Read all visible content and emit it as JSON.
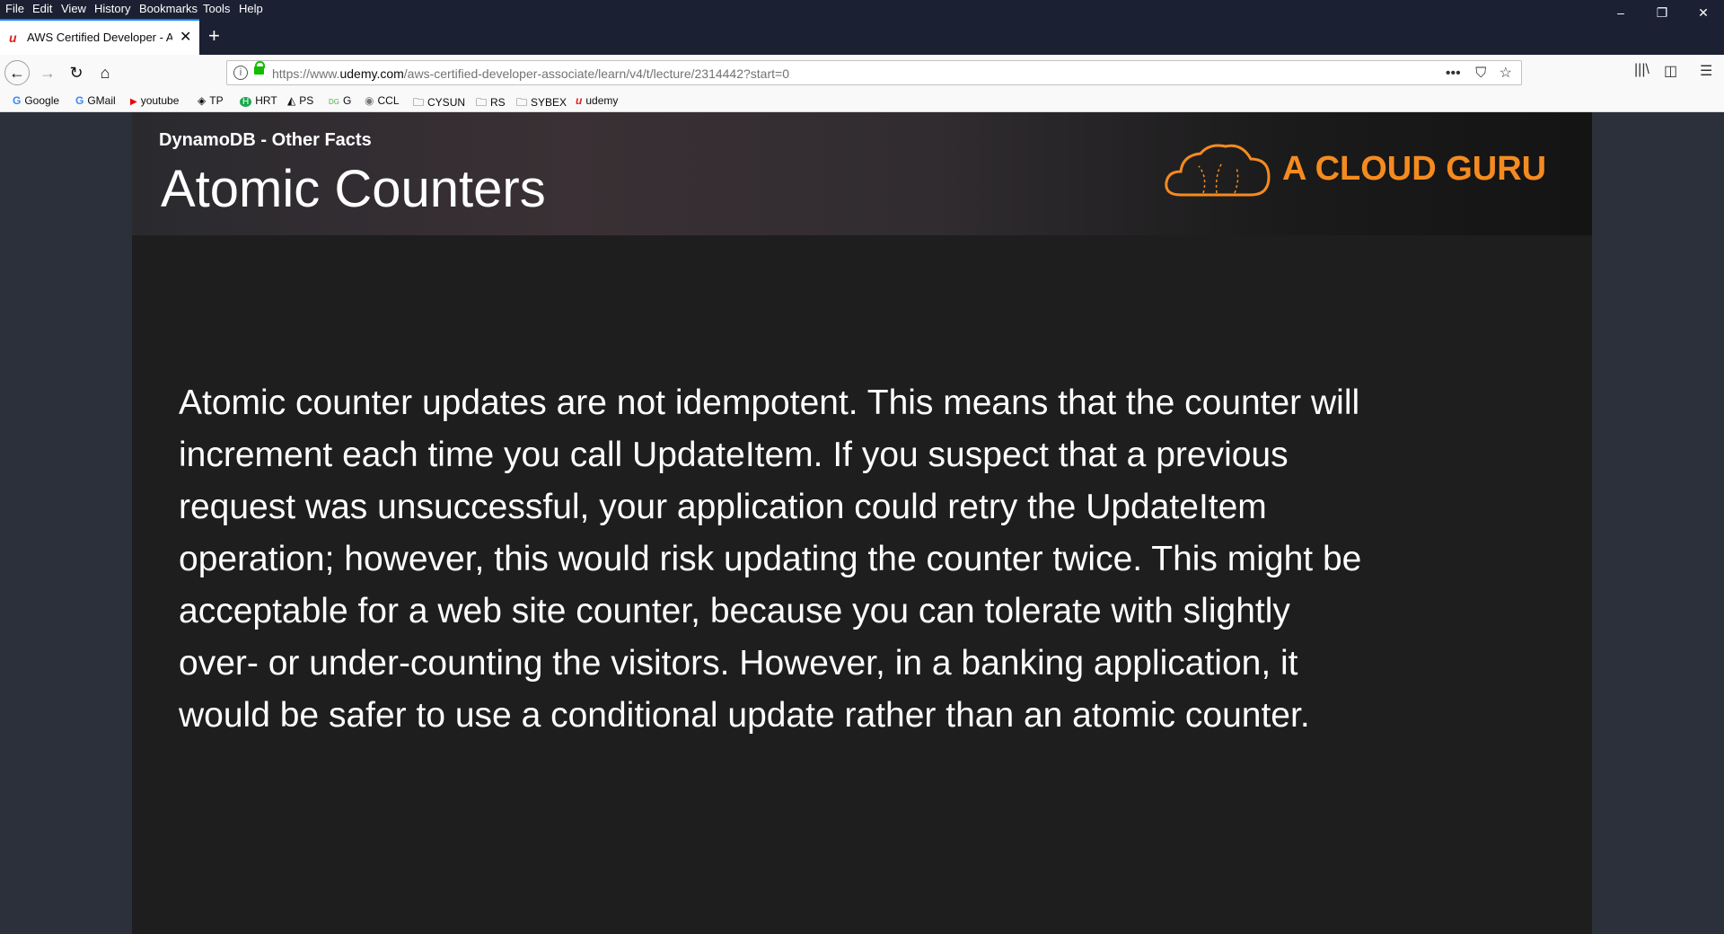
{
  "menu": [
    "File",
    "Edit",
    "View",
    "History",
    "Bookmarks",
    "Tools",
    "Help"
  ],
  "window_controls": {
    "minimize": "–",
    "restore": "❐",
    "close": "✕"
  },
  "tab": {
    "favicon": "u",
    "title": "AWS Certified Developer - Asso",
    "close": "✕"
  },
  "newtab": "+",
  "nav": {
    "back": "←",
    "forward": "→",
    "reload": "↻",
    "home": "⌂"
  },
  "url": {
    "prefix": "https://www.",
    "domain": "udemy.com",
    "path": "/aws-certified-developer-associate/learn/v4/t/lecture/2314442?start=0",
    "more": "•••",
    "pocket": "⛉",
    "star": "☆"
  },
  "toolbar_right": {
    "library": "|||\\",
    "sidebar": "◫",
    "menu": "☰"
  },
  "bookmarks": [
    {
      "icon": "G",
      "label": "Google"
    },
    {
      "icon": "G",
      "label": "GMail"
    },
    {
      "icon": "▶",
      "label": "youtube"
    },
    {
      "icon": "◈",
      "label": "TP"
    },
    {
      "icon": "H",
      "label": "HRT"
    },
    {
      "icon": "◭",
      "label": "PS"
    },
    {
      "icon": "DG",
      "label": "G"
    },
    {
      "icon": "◉",
      "label": "CCL"
    },
    {
      "icon": "🗀",
      "label": "CYSUN"
    },
    {
      "icon": "🗀",
      "label": "RS"
    },
    {
      "icon": "🗀",
      "label": "SYBEX"
    },
    {
      "icon": "u",
      "label": "udemy"
    }
  ],
  "slide": {
    "subtitle": "DynamoDB - Other Facts",
    "title": "Atomic Counters",
    "logo_text": "A CLOUD GURU",
    "body_lines": [
      "Atomic counter updates are not idempotent. This means that the counter will",
      "increment each time you call UpdateItem. If you suspect that a previous",
      "request was unsuccessful, your application could retry the UpdateItem",
      "operation; however, this would risk updating the counter twice. This might be",
      "acceptable for a web site counter, because you can tolerate with slightly",
      "over- or under-counting the visitors. However, in a banking application, it",
      "would be safer to use a conditional update rather than an atomic counter."
    ]
  }
}
